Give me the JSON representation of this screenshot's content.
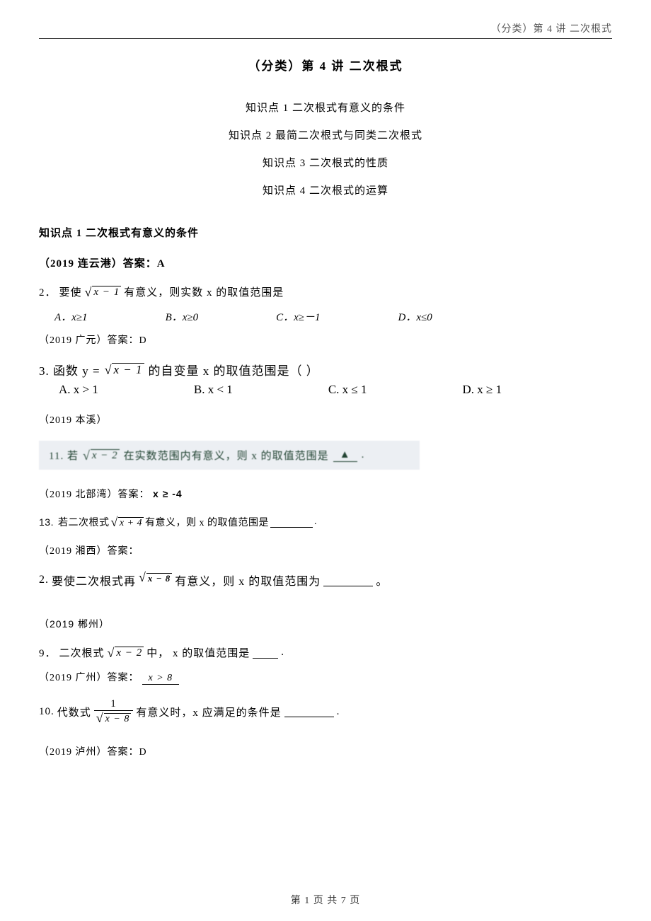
{
  "header": {
    "running_head": "（分类）第 4 讲  二次根式"
  },
  "title": "（分类）第 4 讲  二次根式",
  "toc": [
    "知识点 1  二次根式有意义的条件",
    "知识点 2  最简二次根式与同类二次根式",
    "知识点 3  二次根式的性质",
    "知识点 4  二次根式的运算"
  ],
  "section1_head": "知识点 1  二次根式有意义的条件",
  "lianyungang": {
    "src": "（2019 连云港）答案：A",
    "q_num": "2．",
    "q_text_before": "要使 ",
    "radicand": "x − 1",
    "q_text_after": " 有意义，则实数 x 的取值范围是",
    "choices": {
      "A": "A．x≥1",
      "B": "B．x≥0",
      "C": "C．x≥－1",
      "D": "D．x≤0"
    }
  },
  "guangyuan": {
    "src": "（2019 广元）答案：D",
    "q_head": "3.  函数 y = ",
    "radicand": "x − 1",
    "q_tail": "的自变量 x 的取值范围是（     ）",
    "choices": {
      "A": "A.  x > 1",
      "B": "B.  x < 1",
      "C": "C.  x ≤ 1",
      "D": "D.  x ≥ 1"
    }
  },
  "benxi": {
    "src": "（2019 本溪）",
    "strip_num": "11.  若",
    "strip_radicand": "x − 2",
    "strip_mid": "在实数范围内有意义，则 x 的取值范围是",
    "strip_blank_mark": "▲",
    "strip_end": "."
  },
  "beibuwan": {
    "src": "（2019 北部湾）答案：",
    "ans": "x ≥ -4",
    "q_num": "13.",
    "q_before": "若二次根式 ",
    "radicand": "x + 4",
    "q_after": " 有意义，则 x 的取值范围是",
    "end": "."
  },
  "xiangxi": {
    "src": "（2019 湘西）答案：",
    "q_num": "2. ",
    "q_before": "要使二次根式再",
    "radicand": "x − 8",
    "q_after": "有意义，则 x 的取值范围为",
    "end": "。"
  },
  "chenzhou": {
    "src": "（2019 郴州）",
    "q_num": "9．",
    "q_before": "二次根式",
    "radicand": "x − 2",
    "q_mid": " 中， x 的取值范围是",
    "end": "."
  },
  "guangzhou": {
    "src": "（2019 广州）答案：",
    "ans": "x > 8",
    "q_num": "10. ",
    "q_before": "代数式 ",
    "frac_num": "1",
    "frac_den_radicand": "x − 8",
    "q_after": " 有意义时，x 应满足的条件是",
    "end": "."
  },
  "luzhou": {
    "src": "（2019 泸州）答案：D"
  },
  "footer": {
    "text_before": "第 ",
    "page": "1",
    "text_mid": " 页 共 ",
    "total": "7",
    "text_after": " 页"
  }
}
